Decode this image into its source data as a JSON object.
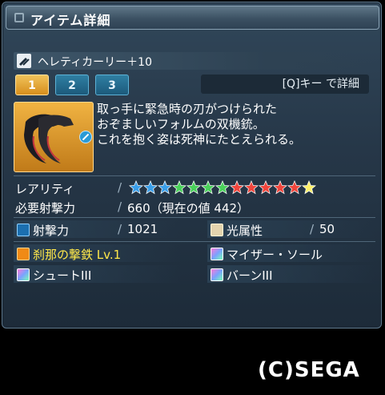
{
  "window": {
    "title": "アイテム詳細"
  },
  "weapon": {
    "name": "ヘレティカーリー＋10"
  },
  "tabs": [
    {
      "label": "1",
      "active": true
    },
    {
      "label": "2",
      "active": false
    },
    {
      "label": "3",
      "active": false
    }
  ],
  "detail_button": {
    "label": "[Q]キー で詳細"
  },
  "description": [
    "取っ手に緊急時の刃がつけられた",
    "おぞましいフォルムの双機銃。",
    "これを抱く姿は死神にたとえられる。"
  ],
  "rarity": {
    "label": "レアリティ",
    "stars": 13,
    "star_colors": [
      "#3a9ee8",
      "#3a9ee8",
      "#3a9ee8",
      "#49d05a",
      "#49d05a",
      "#49d05a",
      "#49d05a",
      "#f0453c",
      "#f0453c",
      "#f0453c",
      "#f0453c",
      "#f0453c",
      "#fff06a"
    ]
  },
  "requirement": {
    "label": "必要射撃力",
    "value": "660（現在の値 442）"
  },
  "stats": {
    "shoot_label": "射撃力",
    "shoot_value": "1021",
    "element_label": "光属性",
    "element_value": "50"
  },
  "abilities": [
    {
      "name": "刹那の撃鉄 Lv.1",
      "highlight": true,
      "icon": "potential-icon"
    },
    {
      "name": "マイザー・ソール",
      "highlight": false,
      "icon": "affix-icon"
    },
    {
      "name": "シュートIII",
      "highlight": false,
      "icon": "affix-icon"
    },
    {
      "name": "バーンIII",
      "highlight": false,
      "icon": "affix-icon"
    }
  ],
  "copyright": "(C)SEGA",
  "colors": {
    "accent": "#f0c25a",
    "highlight_text": "#ffe84a",
    "panel": "#263748"
  }
}
